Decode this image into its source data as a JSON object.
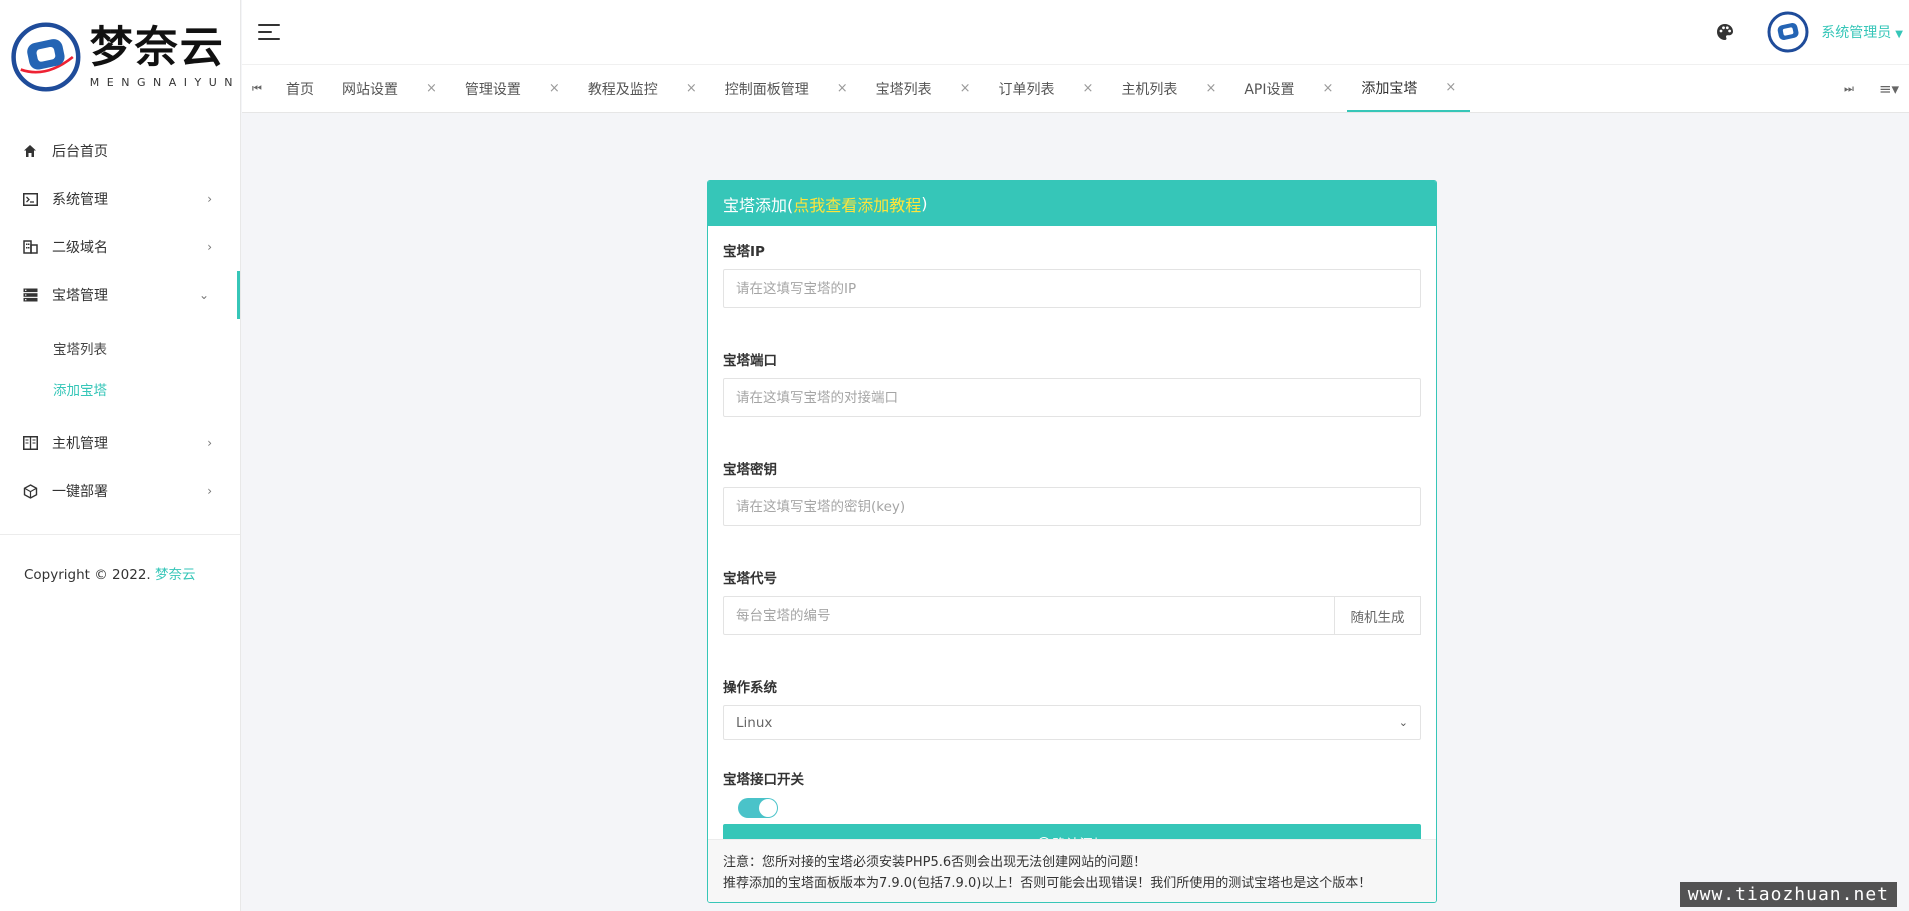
{
  "brand": {
    "cn": "梦奈云",
    "en": "MENGNAIYUN",
    "accent": "#36c6b8",
    "link_color": "#ffe43a"
  },
  "sidebar": {
    "items": [
      {
        "label": "后台首页",
        "icon": "home-icon"
      },
      {
        "label": "系统管理",
        "icon": "terminal-icon"
      },
      {
        "label": "二级域名",
        "icon": "building-icon"
      },
      {
        "label": "宝塔管理",
        "icon": "server-icon"
      },
      {
        "label": "主机管理",
        "icon": "book-icon"
      },
      {
        "label": "一键部署",
        "icon": "cube-icon"
      }
    ],
    "submenu": [
      {
        "label": "宝塔列表"
      },
      {
        "label": "添加宝塔"
      }
    ],
    "copyright_prefix": "Copyright © 2022.",
    "copyright_brand": "梦奈云"
  },
  "header": {
    "user": "系统管理员"
  },
  "tabs": [
    {
      "label": "首页"
    },
    {
      "label": "网站设置"
    },
    {
      "label": "管理设置"
    },
    {
      "label": "教程及监控"
    },
    {
      "label": "控制面板管理"
    },
    {
      "label": "宝塔列表"
    },
    {
      "label": "订单列表"
    },
    {
      "label": "主机列表"
    },
    {
      "label": "API设置"
    },
    {
      "label": "添加宝塔"
    }
  ],
  "form": {
    "title_prefix": "宝塔添加(",
    "title_link": "点我查看添加教程",
    "title_suffix": ")",
    "ip_label": "宝塔IP",
    "ip_placeholder": "请在这填写宝塔的IP",
    "port_label": "宝塔端口",
    "port_placeholder": "请在这填写宝塔的对接端口",
    "key_label": "宝塔密钥",
    "key_placeholder": "请在这填写宝塔的密钥(key)",
    "code_label": "宝塔代号",
    "code_placeholder": "每台宝塔的编号",
    "random_button": "随机生成",
    "os_label": "操作系统",
    "os_value": "Linux",
    "switch_label": "宝塔接口开关",
    "switch_on": true,
    "submit_label": "确认添加",
    "note_line1": "注意：您所对接的宝塔必须安装PHP5.6否则会出现无法创建网站的问题！",
    "note_line2": "推荐添加的宝塔面板版本为7.9.0(包括7.9.0)以上！否则可能会出现错误！我们所使用的测试宝塔也是这个版本！"
  },
  "watermark": "www.tiaozhuan.net"
}
